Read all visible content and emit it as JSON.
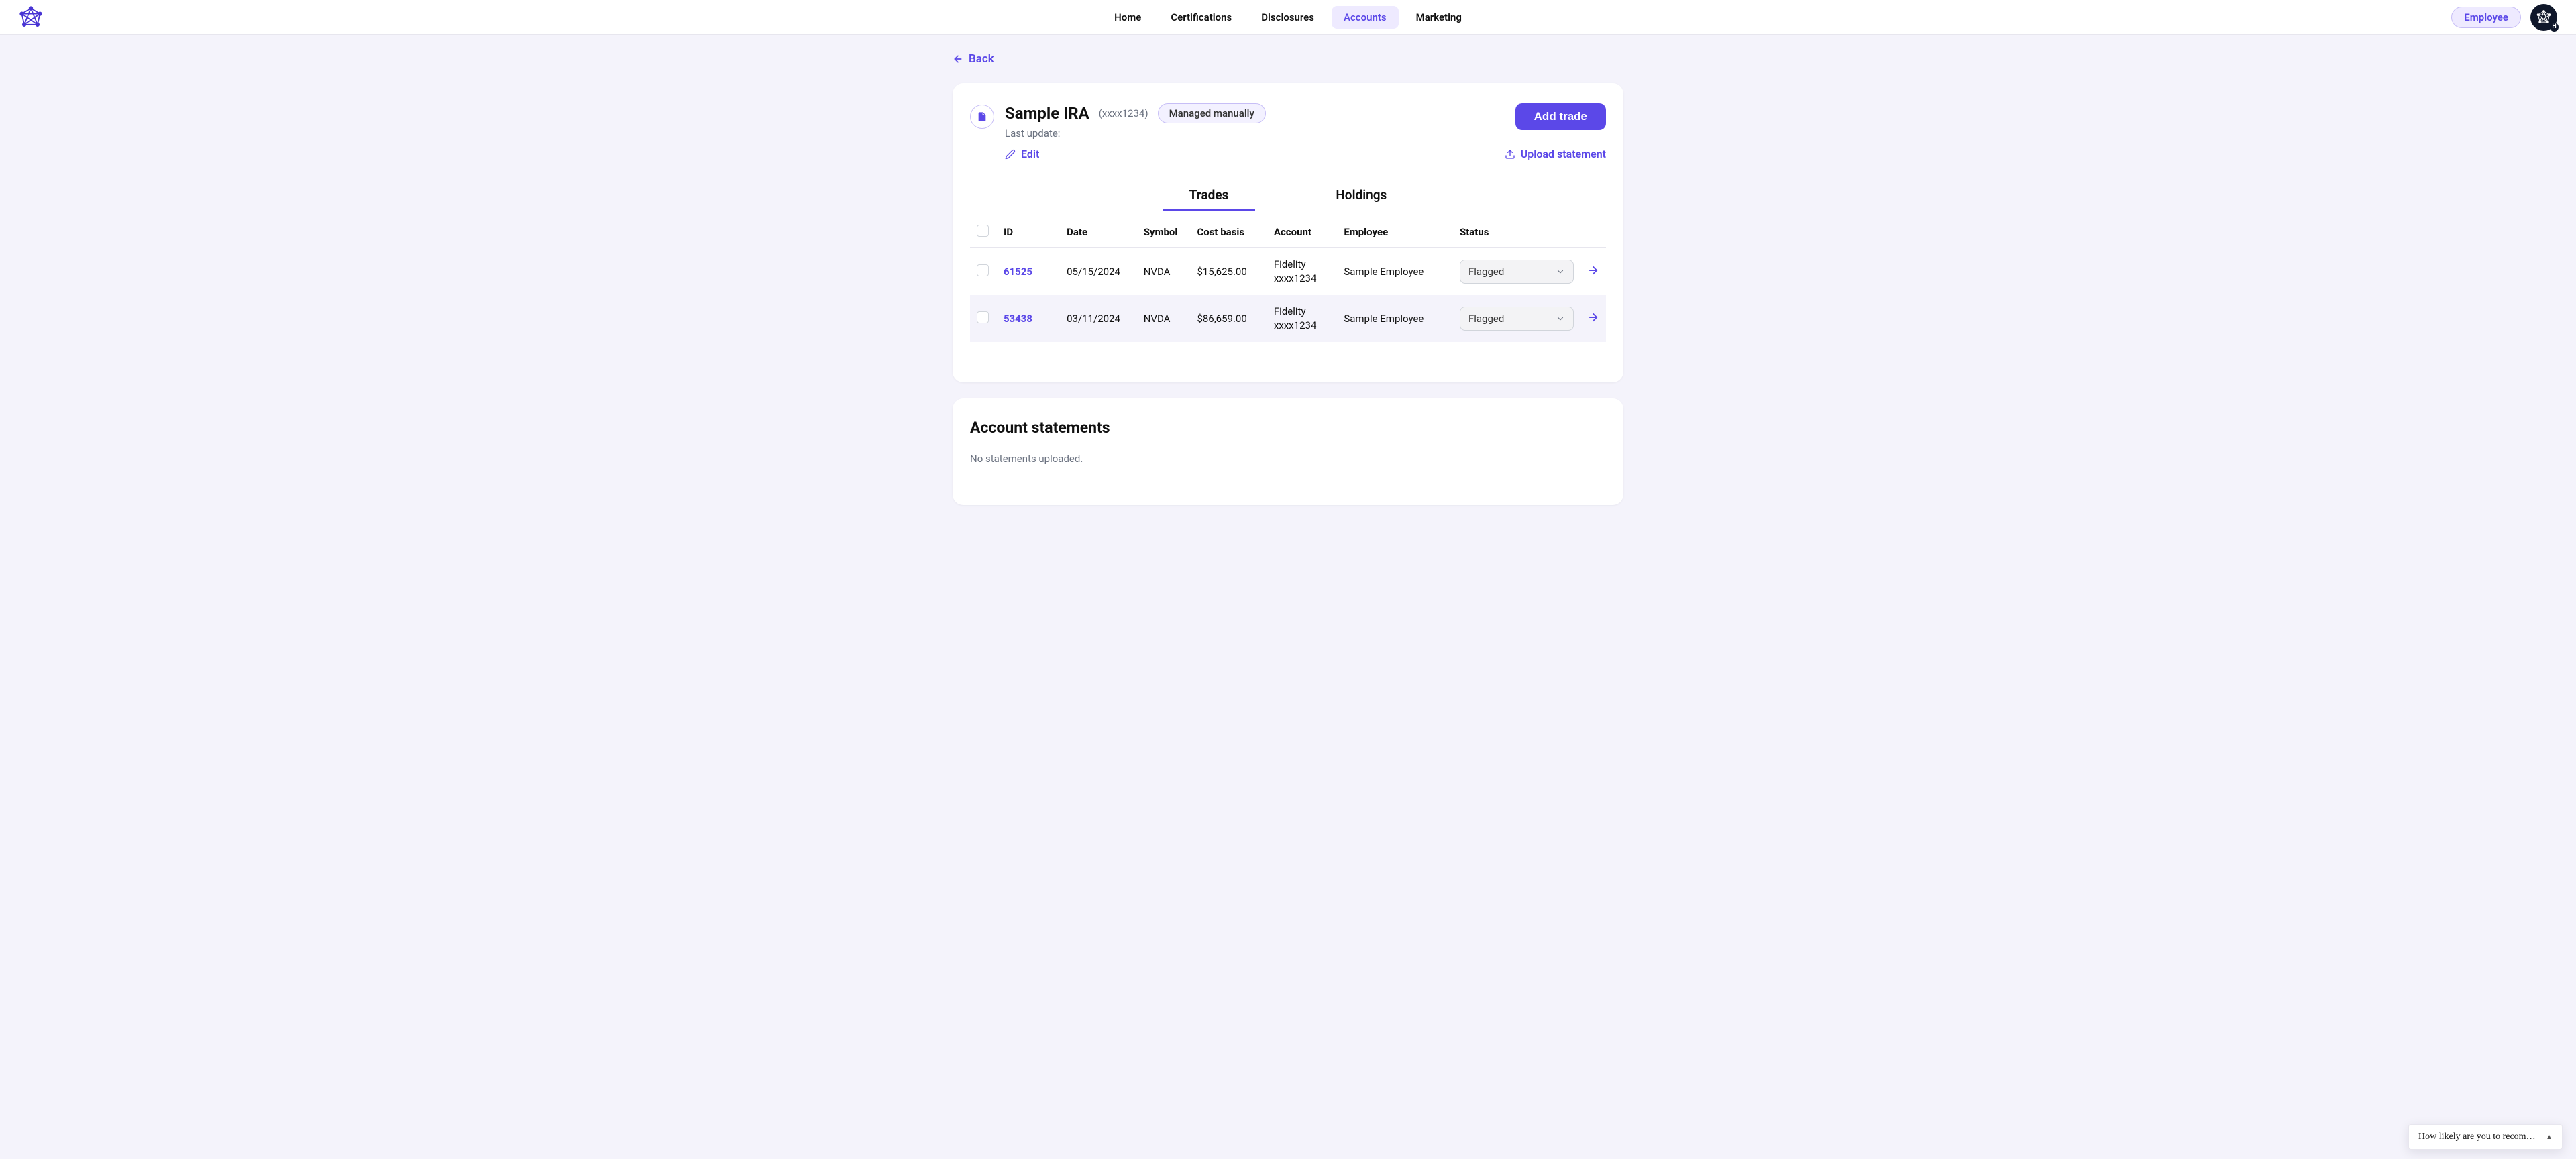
{
  "nav": {
    "items": [
      {
        "label": "Home",
        "active": false
      },
      {
        "label": "Certifications",
        "active": false
      },
      {
        "label": "Disclosures",
        "active": false
      },
      {
        "label": "Accounts",
        "active": true
      },
      {
        "label": "Marketing",
        "active": false
      }
    ],
    "role": "Employee"
  },
  "back_label": "Back",
  "account": {
    "name": "Sample IRA",
    "mask": "(xxxx1234)",
    "management_badge": "Managed manually",
    "last_update_label": "Last update:",
    "last_update_value": "",
    "edit_label": "Edit",
    "add_trade_label": "Add trade",
    "upload_label": "Upload statement"
  },
  "tabs": {
    "trades": "Trades",
    "holdings": "Holdings",
    "active": "trades"
  },
  "table": {
    "columns": {
      "id": "ID",
      "date": "Date",
      "symbol": "Symbol",
      "cost_basis": "Cost basis",
      "account": "Account",
      "employee": "Employee",
      "status": "Status"
    },
    "rows": [
      {
        "id": "61525",
        "date": "05/15/2024",
        "symbol": "NVDA",
        "cost_basis": "$15,625.00",
        "account_line1": "Fidelity",
        "account_line2": "xxxx1234",
        "employee": "Sample Employee",
        "status": "Flagged"
      },
      {
        "id": "53438",
        "date": "03/11/2024",
        "symbol": "NVDA",
        "cost_basis": "$86,659.00",
        "account_line1": "Fidelity",
        "account_line2": "xxxx1234",
        "employee": "Sample Employee",
        "status": "Flagged"
      }
    ]
  },
  "statements": {
    "title": "Account statements",
    "empty_text": "No statements uploaded."
  },
  "survey": {
    "text": "How likely are you to recommen…"
  }
}
